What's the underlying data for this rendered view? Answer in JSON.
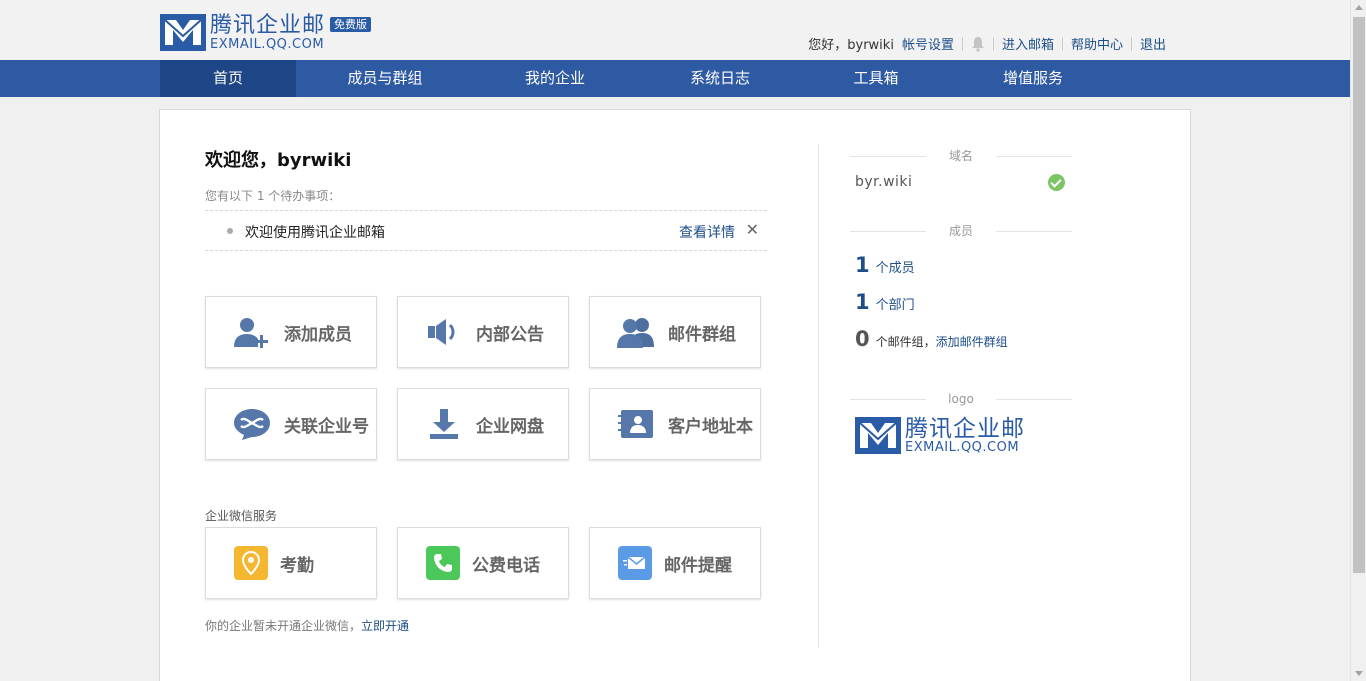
{
  "brand": {
    "name_cn": "腾讯企业邮",
    "name_en": "EXMAIL.QQ.COM",
    "badge": "免费版",
    "color": "#2a5ba6"
  },
  "user_nav": {
    "greeting": "您好，byrwiki",
    "account_settings": "帐号设置",
    "enter_mailbox": "进入邮箱",
    "help_center": "帮助中心",
    "logout": "退出"
  },
  "main_nav": {
    "items": [
      {
        "label": "首页",
        "active": true
      },
      {
        "label": "成员与群组",
        "active": false
      },
      {
        "label": "我的企业",
        "active": false
      },
      {
        "label": "系统日志",
        "active": false
      },
      {
        "label": "工具箱",
        "active": false
      },
      {
        "label": "增值服务",
        "active": false
      }
    ]
  },
  "welcome": {
    "title": "欢迎您，byrwiki",
    "todo_hint": "您有以下 1 个待办事项：",
    "todo_item": "欢迎使用腾讯企业邮箱",
    "todo_detail": "查看详情",
    "todo_close": "✕"
  },
  "quick_actions": [
    {
      "label": "添加成员",
      "icon": "add-user-icon"
    },
    {
      "label": "内部公告",
      "icon": "speaker-icon"
    },
    {
      "label": "邮件群组",
      "icon": "group-icon"
    },
    {
      "label": "关联企业号",
      "icon": "link-icon"
    },
    {
      "label": "企业网盘",
      "icon": "download-icon"
    },
    {
      "label": "客户地址本",
      "icon": "contact-book-icon"
    }
  ],
  "wechat": {
    "title": "企业微信服务",
    "services": [
      {
        "label": "考勤",
        "icon": "location-pin-icon",
        "color": "#f5b730"
      },
      {
        "label": "公费电话",
        "icon": "phone-icon",
        "color": "#4cc75a"
      },
      {
        "label": "邮件提醒",
        "icon": "mail-icon",
        "color": "#5b9be6"
      }
    ],
    "note": "你的企业暂未开通企业微信，",
    "activate": "立即开通"
  },
  "sidebar": {
    "domain_title": "域名",
    "domain": "byr.wiki",
    "members_title": "成员",
    "member_count": "1",
    "member_unit": "个成员",
    "department_count": "1",
    "department_unit": "个部门",
    "mail_group_count": "0",
    "mail_group_unit": "个邮件组，",
    "add_mail_group": "添加邮件群组",
    "logo_title": "logo"
  }
}
